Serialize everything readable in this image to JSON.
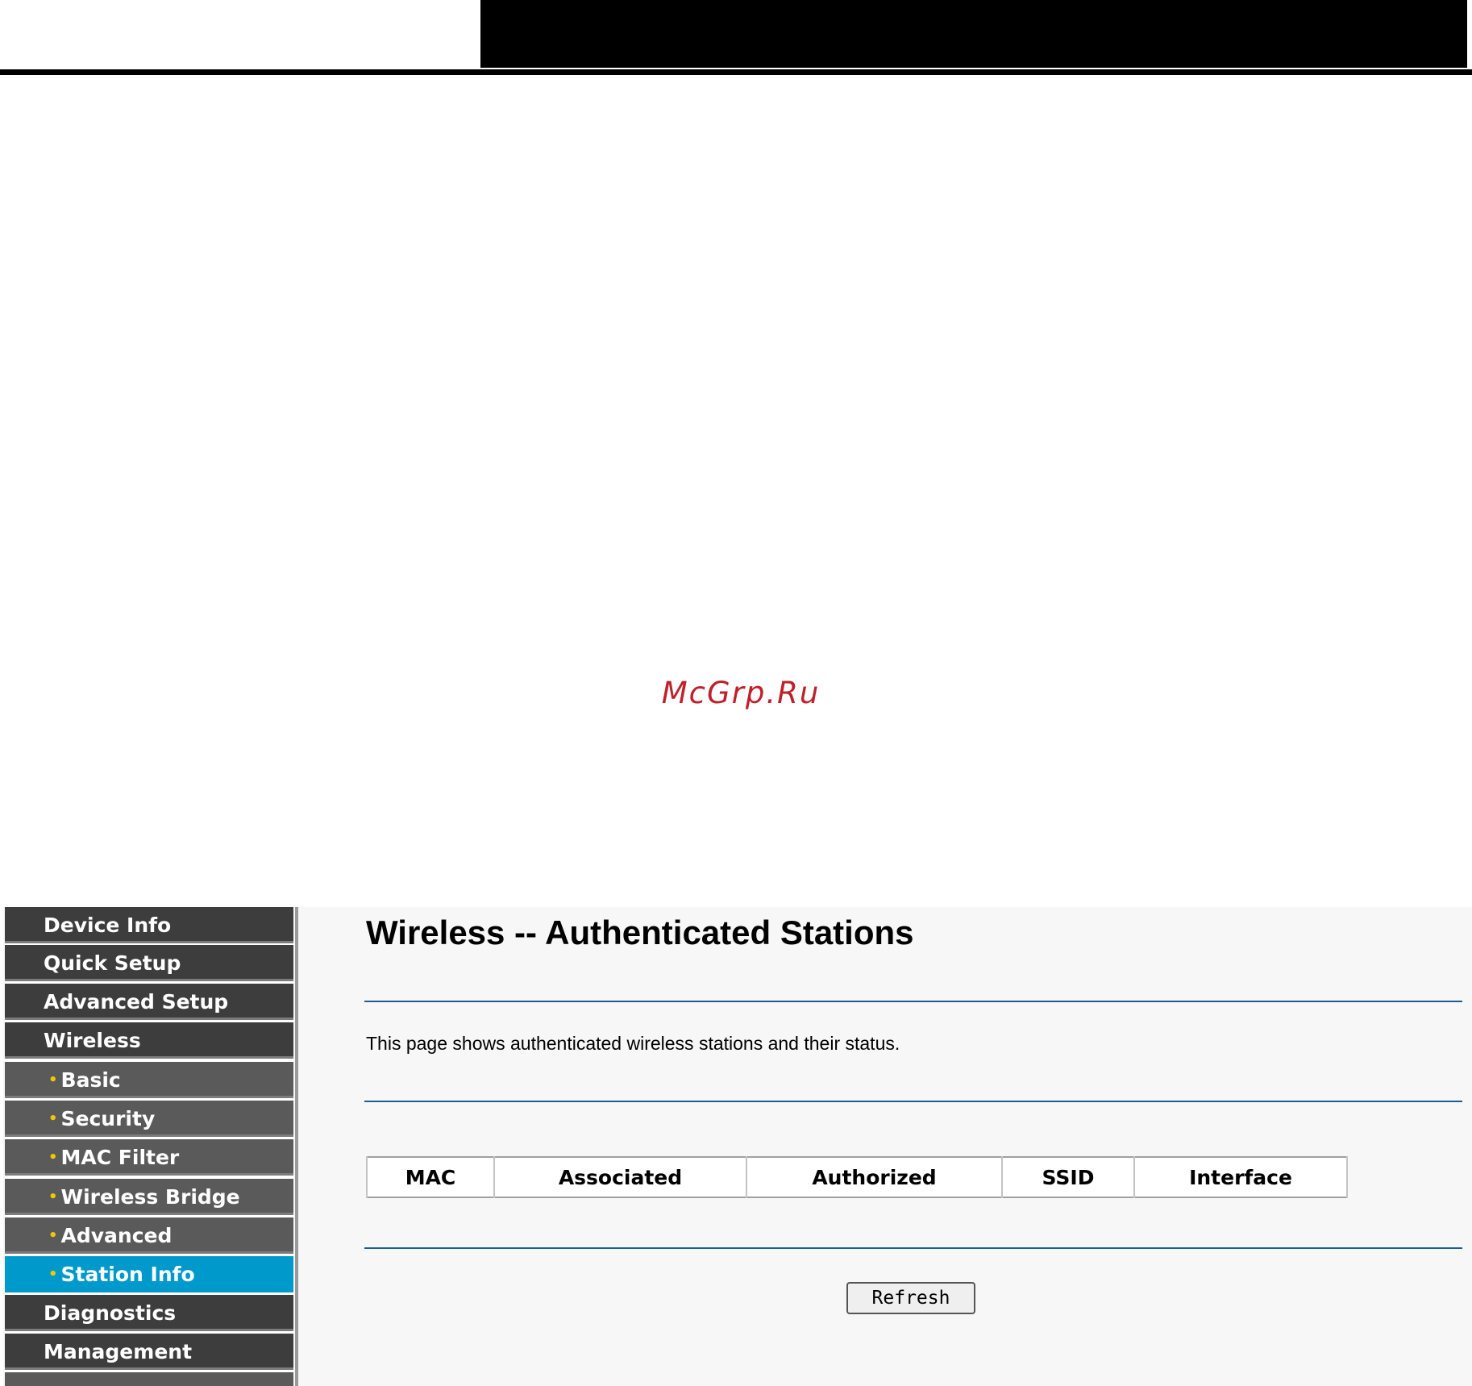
{
  "watermark": "McGrp.Ru",
  "sidebar": {
    "items": [
      {
        "label": "Device Info",
        "level": "main",
        "active": false
      },
      {
        "label": "Quick Setup",
        "level": "main",
        "active": false
      },
      {
        "label": "Advanced Setup",
        "level": "main",
        "active": false
      },
      {
        "label": "Wireless",
        "level": "main",
        "active": false
      },
      {
        "label": "Basic",
        "level": "sub",
        "active": false
      },
      {
        "label": "Security",
        "level": "sub",
        "active": false
      },
      {
        "label": "MAC Filter",
        "level": "sub",
        "active": false
      },
      {
        "label": "Wireless Bridge",
        "level": "sub",
        "active": false
      },
      {
        "label": "Advanced",
        "level": "sub",
        "active": false
      },
      {
        "label": "Station Info",
        "level": "sub",
        "active": true
      },
      {
        "label": "Diagnostics",
        "level": "main",
        "active": false
      },
      {
        "label": "Management",
        "level": "main",
        "active": false
      }
    ],
    "bullet": "•"
  },
  "main": {
    "title": "Wireless -- Authenticated Stations",
    "description": "This page shows authenticated wireless stations and their status.",
    "table": {
      "columns": [
        "MAC",
        "Associated",
        "Authorized",
        "SSID",
        "Interface"
      ],
      "rows": []
    },
    "refresh_label": "Refresh"
  },
  "colors": {
    "nav_main": "#3d3d3d",
    "nav_sub": "#5a5a5a",
    "nav_active": "#0099cc",
    "bullet": "#f0c800",
    "rule": "#1a5f8f",
    "watermark": "#c0202a"
  }
}
